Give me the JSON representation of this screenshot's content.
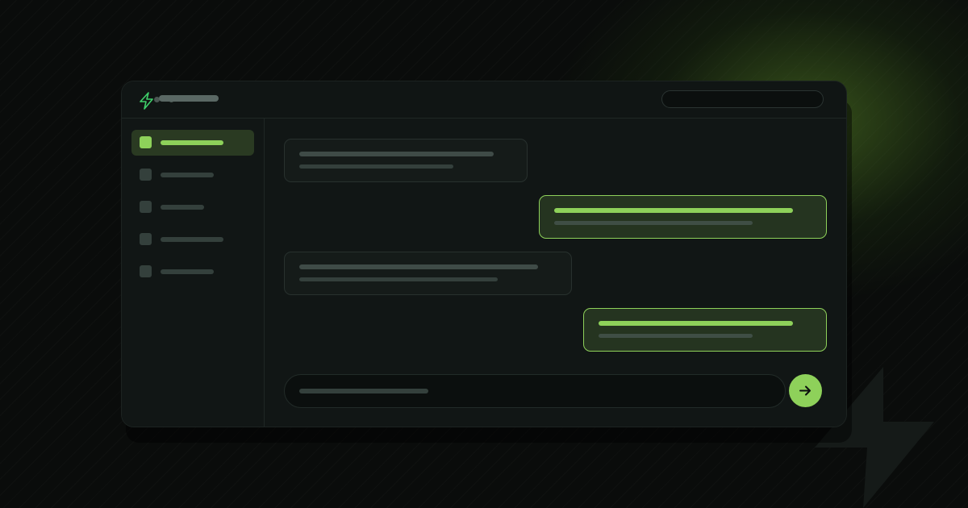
{
  "window": {
    "app_title": "",
    "search": {
      "placeholder": "",
      "value": ""
    }
  },
  "sidebar": {
    "items": [
      {
        "label": "",
        "active": true
      },
      {
        "label": "",
        "active": false
      },
      {
        "label": "",
        "active": false
      },
      {
        "label": "",
        "active": false
      },
      {
        "label": "",
        "active": false
      }
    ]
  },
  "chat": {
    "messages": [
      {
        "role": "incoming",
        "text": ""
      },
      {
        "role": "outgoing",
        "text": ""
      },
      {
        "role": "incoming",
        "text": ""
      },
      {
        "role": "outgoing",
        "text": ""
      }
    ],
    "composer": {
      "placeholder": "",
      "value": ""
    }
  },
  "icons": {
    "logo": "lightning-bolt-icon",
    "send": "arrow-right-icon",
    "background": "lightning-bolt-icon"
  },
  "colors": {
    "accent": "#8ed15a",
    "background": "#0a0c0b",
    "window": "#111615",
    "outgoing_bubble": "#253420"
  }
}
